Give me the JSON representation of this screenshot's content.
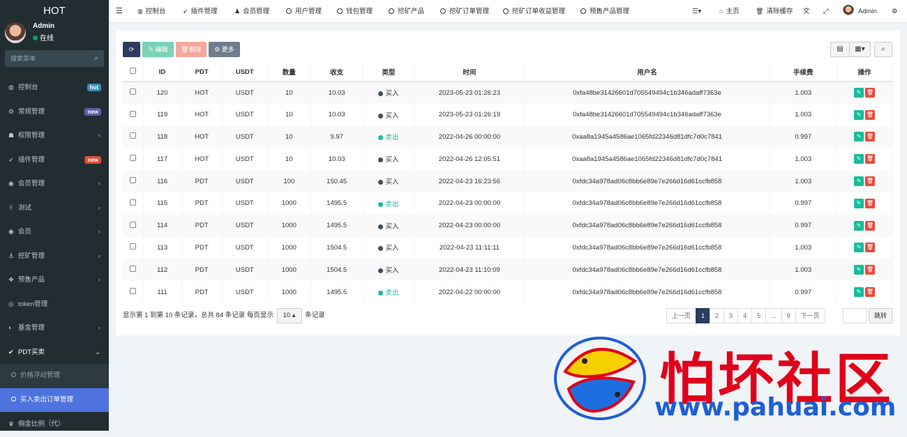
{
  "app": {
    "logo": "HOT"
  },
  "user": {
    "name": "Admin",
    "status": "在线"
  },
  "search": {
    "placeholder": "搜索菜单"
  },
  "sidebar": {
    "items": [
      {
        "label": "控制台",
        "icon": "dashboard-icon",
        "badge": "hot",
        "badge_color": "#3c8dbc"
      },
      {
        "label": "常规管理",
        "icon": "cogs-icon",
        "badge": "new",
        "badge_color": "#605ca8"
      },
      {
        "label": "权限管理",
        "icon": "group-icon",
        "arrow": "‹"
      },
      {
        "label": "插件管理",
        "icon": "rocket-icon",
        "badge": "new",
        "badge_color": "#dd4b39"
      },
      {
        "label": "会员管理",
        "icon": "user-circle-icon",
        "arrow": "‹"
      },
      {
        "label": "测试",
        "icon": "test-icon",
        "arrow": "‹"
      },
      {
        "label": "会员",
        "icon": "user-circle-icon",
        "arrow": "‹"
      },
      {
        "label": "挖矿管理",
        "icon": "anchor-icon",
        "arrow": "‹"
      },
      {
        "label": "预售产品",
        "icon": "cubes-icon",
        "arrow": "‹"
      },
      {
        "label": "token管理",
        "icon": "coin-icon"
      },
      {
        "label": "基金管理",
        "icon": "adjust-icon",
        "arrow": "‹"
      },
      {
        "label": "PDT买卖",
        "icon": "check-circle-icon",
        "arrow": "⌄"
      }
    ],
    "sub_items": [
      {
        "label": "价格浮动管理"
      },
      {
        "label": "买入卖出订单管理"
      }
    ],
    "last_item": {
      "label": "佣金比例（代）",
      "icon": "trophy-icon"
    }
  },
  "topnav": {
    "menu_icon": "hamburger-icon",
    "tabs": [
      {
        "label": "控制台",
        "icon": "dashboard-icon"
      },
      {
        "label": "插件管理",
        "icon": "rocket-icon"
      },
      {
        "label": "会员管理",
        "icon": "user-icon"
      },
      {
        "label": "用户管理",
        "icon": "circle-icon"
      },
      {
        "label": "钱包管理",
        "icon": "circle-icon"
      },
      {
        "label": "挖矿产品",
        "icon": "circle-icon"
      },
      {
        "label": "挖矿订单管理",
        "icon": "circle-icon"
      },
      {
        "label": "挖矿订单收益管理",
        "icon": "circle-icon"
      },
      {
        "label": "预售产品管理",
        "icon": "circle-icon"
      }
    ],
    "right": {
      "home": "主页",
      "clear_cache": "清除缓存",
      "user": "Admin"
    }
  },
  "toolbar": {
    "edit": "编辑",
    "delete": "删除",
    "more": "更多"
  },
  "table": {
    "headers": [
      "ID",
      "PDT",
      "USDT",
      "数量",
      "收支",
      "类型",
      "时间",
      "用户名",
      "手续费",
      "操作"
    ],
    "rows": [
      {
        "id": "120",
        "pdt": "HOT",
        "usdt": "USDT",
        "qty": "10",
        "amount": "10.03",
        "type": "买入",
        "time": "2023-05-23 01:26:23",
        "user": "0xfa48be31426601d705549494c1b346adaff7363e",
        "fee": "1.003"
      },
      {
        "id": "119",
        "pdt": "HOT",
        "usdt": "USDT",
        "qty": "10",
        "amount": "10.03",
        "type": "买入",
        "time": "2023-05-23 01:26:19",
        "user": "0xfa48be31426601d705549494c1b346adaff7363e",
        "fee": "1.003"
      },
      {
        "id": "118",
        "pdt": "HOT",
        "usdt": "USDT",
        "qty": "10",
        "amount": "9.97",
        "type": "卖出",
        "time": "2022-04-26 00:00:00",
        "user": "0xaa8a1945a4586ae1065fd22346d81dfc7d0c7841",
        "fee": "0.997"
      },
      {
        "id": "117",
        "pdt": "HOT",
        "usdt": "USDT",
        "qty": "10",
        "amount": "10.03",
        "type": "买入",
        "time": "2022-04-26 12:05:51",
        "user": "0xaa8a1945a4586ae1065fd22346d81dfc7d0c7841",
        "fee": "1.003"
      },
      {
        "id": "116",
        "pdt": "PDT",
        "usdt": "USDT",
        "qty": "100",
        "amount": "150.45",
        "type": "买入",
        "time": "2022-04-23 16:23:56",
        "user": "0xfdc34a978ad06c8bb6e89e7e266d16d61ccfb858",
        "fee": "1.003"
      },
      {
        "id": "115",
        "pdt": "PDT",
        "usdt": "USDT",
        "qty": "1000",
        "amount": "1495.5",
        "type": "卖出",
        "time": "2022-04-23 00:00:00",
        "user": "0xfdc34a978ad06c8bb6e89e7e266d16d61ccfb858",
        "fee": "0.997"
      },
      {
        "id": "114",
        "pdt": "PDT",
        "usdt": "USDT",
        "qty": "1000",
        "amount": "1495.5",
        "type": "买入",
        "time": "2022-04-23 00:00:00",
        "user": "0xfdc34a978ad06c8bb6e89e7e266d16d61ccfb858",
        "fee": "0.997"
      },
      {
        "id": "113",
        "pdt": "PDT",
        "usdt": "USDT",
        "qty": "1000",
        "amount": "1504.5",
        "type": "买入",
        "time": "2022-04-23 11:11:11",
        "user": "0xfdc34a978ad06c8bb6e89e7e266d16d61ccfb858",
        "fee": "1.003"
      },
      {
        "id": "112",
        "pdt": "PDT",
        "usdt": "USDT",
        "qty": "1000",
        "amount": "1504.5",
        "type": "买入",
        "time": "2022-04-23 11:10:09",
        "user": "0xfdc34a978ad06c8bb6e89e7e266d16d61ccfb858",
        "fee": "1.003"
      },
      {
        "id": "111",
        "pdt": "PDT",
        "usdt": "USDT",
        "qty": "1000",
        "amount": "1495.5",
        "type": "卖出",
        "time": "2022-04-22 00:00:00",
        "user": "0xfdc34a978ad06c8bb6e89e7e266d16d61ccfb858",
        "fee": "0.997"
      }
    ]
  },
  "type_colors": {
    "买入": "#444c63",
    "卖出": "#18bc9c"
  },
  "footer": {
    "info_prefix": "显示第 1 到第 10 条记录，总共 84 条记录 每页显示",
    "page_size": "10",
    "info_suffix": "条记录"
  },
  "pagination": {
    "prev": "上一页",
    "pages": [
      "1",
      "2",
      "3",
      "4",
      "5",
      "...",
      "9"
    ],
    "next": "下一页",
    "jump": "跳转"
  },
  "watermark": {
    "title": "怕坏社区",
    "url": "www.pahuai.com"
  }
}
